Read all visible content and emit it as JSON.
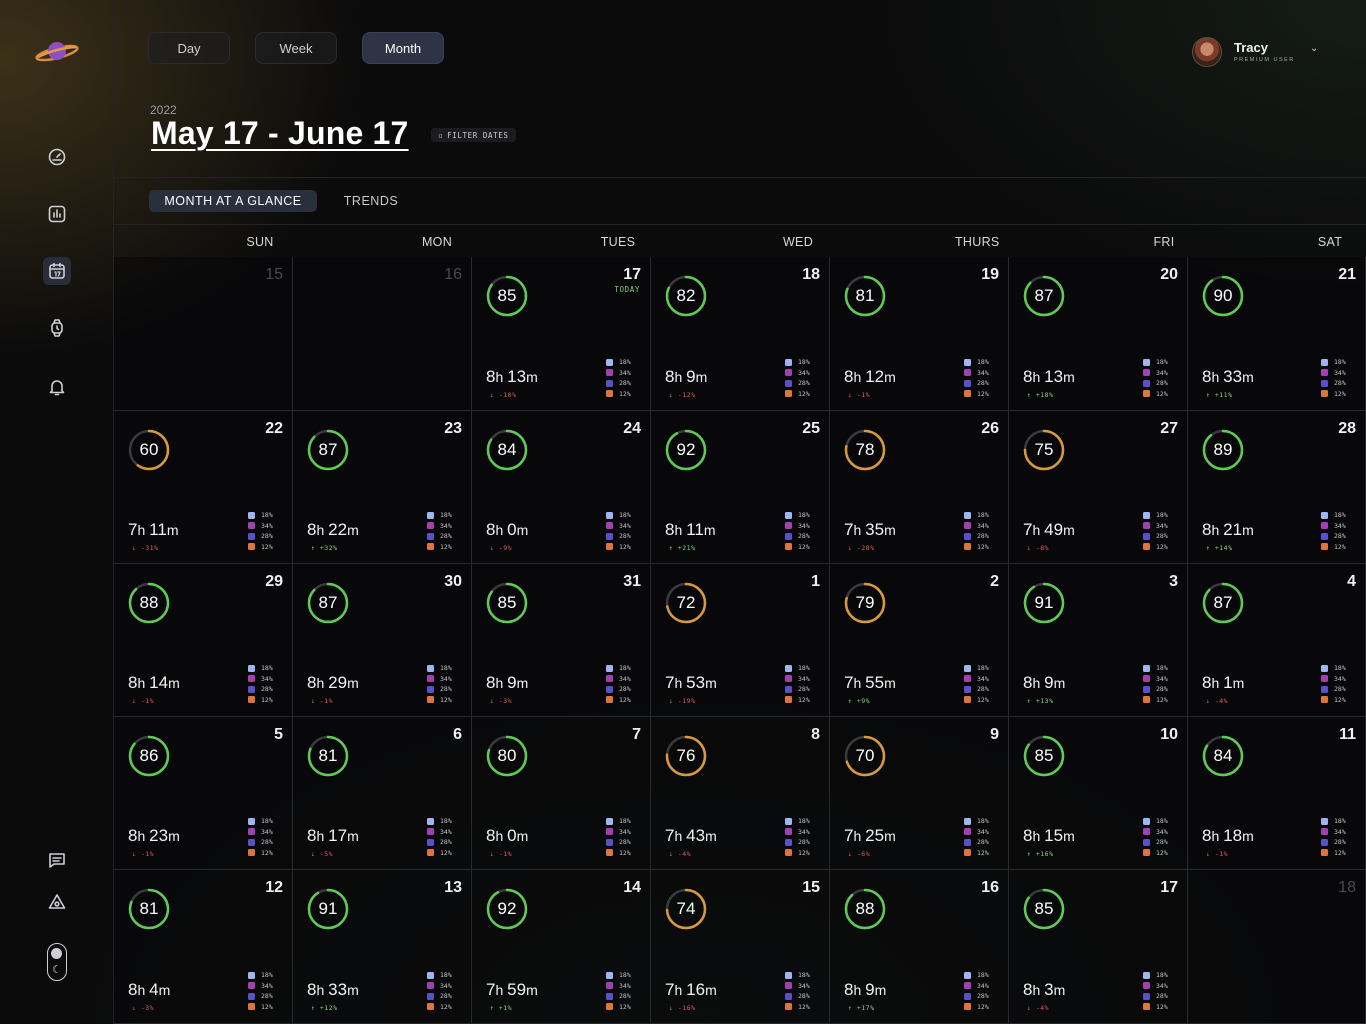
{
  "nav": {
    "icons": [
      "logo-planet-icon",
      "dashboard-gauge-icon",
      "stats-chart-icon",
      "calendar-icon",
      "watch-icon",
      "bell-icon",
      "chat-icon",
      "alert-icon",
      "theme-toggle-icon"
    ]
  },
  "view_switch": {
    "day": "Day",
    "week": "Week",
    "month": "Month",
    "active": "month"
  },
  "user": {
    "name": "Tracy",
    "badge": "PREMIUM USER"
  },
  "header": {
    "year": "2022",
    "range": "May 17 - June 17",
    "filter": "FILTER DATES"
  },
  "tabs": {
    "glance": "MONTH AT A GLANCE",
    "trends": "TRENDS"
  },
  "weekdays": [
    "SUN",
    "MON",
    "TUES",
    "WED",
    "THURS",
    "FRI",
    "SAT"
  ],
  "today_label": "TODAY",
  "legend": {
    "colors": [
      "#9fb6f2",
      "#a43fb3",
      "#5a50c8",
      "#e0753a"
    ],
    "values": [
      "18%",
      "34%",
      "28%",
      "12%"
    ]
  },
  "colors": {
    "ring_good": "#5fcb55",
    "ring_mid": "#d99a3a",
    "track": "#3a3a3e"
  },
  "days": [
    {
      "d": "15",
      "muted": true
    },
    {
      "d": "16",
      "muted": true
    },
    {
      "d": "17",
      "today": true,
      "score": 85,
      "h": "8",
      "m": "13",
      "chg": "↓ -10%",
      "dir": "down"
    },
    {
      "d": "18",
      "score": 82,
      "h": "8",
      "m": "9",
      "chg": "↓ -12%",
      "dir": "down"
    },
    {
      "d": "19",
      "score": 81,
      "h": "8",
      "m": "12",
      "chg": "↓ -1%",
      "dir": "down"
    },
    {
      "d": "20",
      "score": 87,
      "h": "8",
      "m": "13",
      "chg": "↑ +18%",
      "dir": "up"
    },
    {
      "d": "21",
      "score": 90,
      "h": "8",
      "m": "33",
      "chg": "↑ +11%",
      "dir": "up"
    },
    {
      "d": "22",
      "score": 60,
      "h": "7",
      "m": "11",
      "chg": "↓ -31%",
      "dir": "down"
    },
    {
      "d": "23",
      "score": 87,
      "h": "8",
      "m": "22",
      "chg": "↑ +32%",
      "dir": "up"
    },
    {
      "d": "24",
      "score": 84,
      "h": "8",
      "m": "0",
      "chg": "↓ -9%",
      "dir": "down"
    },
    {
      "d": "25",
      "score": 92,
      "h": "8",
      "m": "11",
      "chg": "↑ +21%",
      "dir": "up"
    },
    {
      "d": "26",
      "score": 78,
      "h": "7",
      "m": "35",
      "chg": "↓ -28%",
      "dir": "down"
    },
    {
      "d": "27",
      "score": 75,
      "h": "7",
      "m": "49",
      "chg": "↓ -8%",
      "dir": "down"
    },
    {
      "d": "28",
      "score": 89,
      "h": "8",
      "m": "21",
      "chg": "↑ +14%",
      "dir": "up"
    },
    {
      "d": "29",
      "score": 88,
      "h": "8",
      "m": "14",
      "chg": "↓ -1%",
      "dir": "down"
    },
    {
      "d": "30",
      "score": 87,
      "h": "8",
      "m": "29",
      "chg": "↓ -1%",
      "dir": "down"
    },
    {
      "d": "31",
      "score": 85,
      "h": "8",
      "m": "9",
      "chg": "↓ -3%",
      "dir": "down"
    },
    {
      "d": "1",
      "score": 72,
      "h": "7",
      "m": "53",
      "chg": "↓ -19%",
      "dir": "down"
    },
    {
      "d": "2",
      "score": 79,
      "h": "7",
      "m": "55",
      "chg": "↑ +9%",
      "dir": "up"
    },
    {
      "d": "3",
      "score": 91,
      "h": "8",
      "m": "9",
      "chg": "↑ +13%",
      "dir": "up"
    },
    {
      "d": "4",
      "score": 87,
      "h": "8",
      "m": "1",
      "chg": "↓ -4%",
      "dir": "down"
    },
    {
      "d": "5",
      "score": 86,
      "h": "8",
      "m": "23",
      "chg": "↓ -1%",
      "dir": "down"
    },
    {
      "d": "6",
      "score": 81,
      "h": "8",
      "m": "17",
      "chg": "↓ -5%",
      "dir": "down"
    },
    {
      "d": "7",
      "score": 80,
      "h": "8",
      "m": "0",
      "chg": "↓ -1%",
      "dir": "down"
    },
    {
      "d": "8",
      "score": 76,
      "h": "7",
      "m": "43",
      "chg": "↓ -4%",
      "dir": "down"
    },
    {
      "d": "9",
      "score": 70,
      "h": "7",
      "m": "25",
      "chg": "↓ -6%",
      "dir": "down"
    },
    {
      "d": "10",
      "score": 85,
      "h": "8",
      "m": "15",
      "chg": "↑ +16%",
      "dir": "up"
    },
    {
      "d": "11",
      "score": 84,
      "h": "8",
      "m": "18",
      "chg": "↓ -1%",
      "dir": "down"
    },
    {
      "d": "12",
      "score": 81,
      "h": "8",
      "m": "4",
      "chg": "↓ -3%",
      "dir": "down"
    },
    {
      "d": "13",
      "score": 91,
      "h": "8",
      "m": "33",
      "chg": "↑ +12%",
      "dir": "up"
    },
    {
      "d": "14",
      "score": 92,
      "h": "7",
      "m": "59",
      "chg": "↑ +1%",
      "dir": "up"
    },
    {
      "d": "15",
      "score": 74,
      "h": "7",
      "m": "16",
      "chg": "↓ -16%",
      "dir": "down"
    },
    {
      "d": "16",
      "score": 88,
      "h": "8",
      "m": "9",
      "chg": "↑ +17%",
      "dir": "up"
    },
    {
      "d": "17",
      "score": 85,
      "h": "8",
      "m": "3",
      "chg": "↓ -4%",
      "dir": "down"
    },
    {
      "d": "18",
      "muted": true
    }
  ]
}
